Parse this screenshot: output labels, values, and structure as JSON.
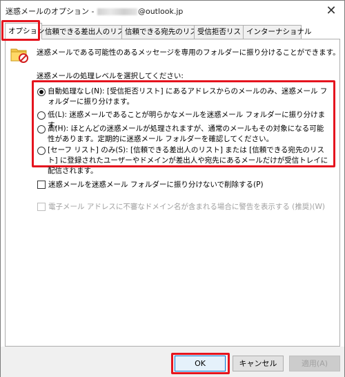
{
  "window": {
    "title_prefix": "迷惑メールのオプション -",
    "title_suffix": "@outlook.jp",
    "close_label": "✕"
  },
  "tabs": [
    {
      "label": "オプション",
      "active": true
    },
    {
      "label": "信頼できる差出人のリスト",
      "active": false
    },
    {
      "label": "信頼できる宛先のリスト",
      "active": false
    },
    {
      "label": "受信拒否リスト",
      "active": false
    },
    {
      "label": "インターナショナル",
      "active": false
    }
  ],
  "options": {
    "intro": "迷惑メールである可能性のあるメッセージを専用のフォルダーに振り分けることができます。",
    "level_label": "迷惑メールの処理レベルを選択してください:",
    "levels": [
      {
        "label": "自動処理なし(N): [受信拒否リスト] にあるアドレスからのメールのみ、迷惑メール フォルダーに振り分けます。",
        "checked": true
      },
      {
        "label": "低(L): 迷惑メールであることが明らかなメールを迷惑メール フォルダーに振り分けます。",
        "checked": false
      },
      {
        "label": "高(H): ほとんどの迷惑メールが処理されますが、通常のメールもその対象になる可能性があります。定期的に迷惑メール フォルダーを確認してください。",
        "checked": false
      },
      {
        "label": "[セーフ リスト] のみ(S): [信頼できる差出人のリスト] または [信頼できる宛先のリスト] に登録されたユーザーやドメインが差出人や宛先にあるメールだけが受信トレイに配信されます。",
        "checked": false
      }
    ],
    "delete_option": "迷惑メールを迷惑メール フォルダーに振り分けないで削除する(P)",
    "warn_option": "電子メール アドレスに不審なドメイン名が含まれる場合に警告を表示する (推奨)(W)"
  },
  "buttons": {
    "ok": "OK",
    "cancel": "キャンセル",
    "apply": "適用(A)"
  },
  "colors": {
    "highlight": "#e5141e",
    "ok_border": "#0078d7"
  }
}
